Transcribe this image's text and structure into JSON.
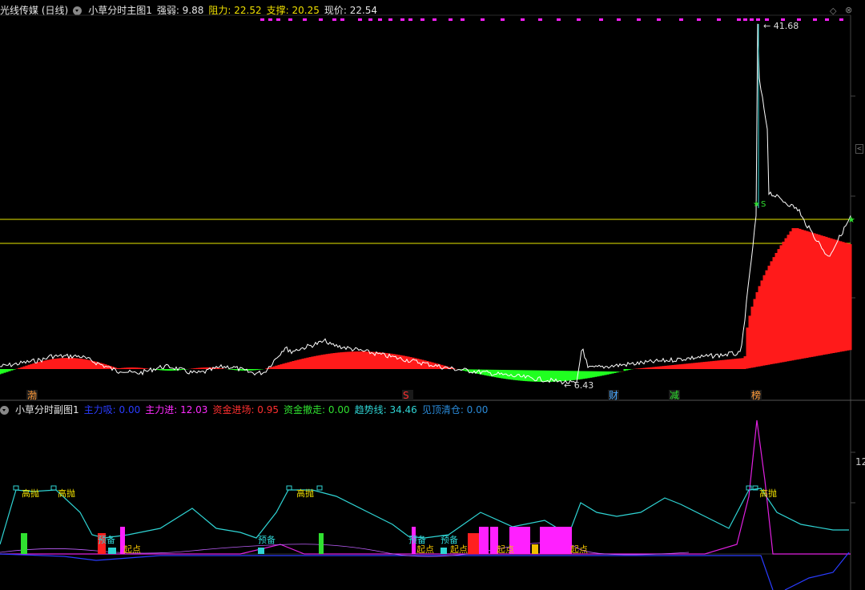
{
  "main_header": {
    "stock": "光线传媒 (日线)",
    "indicator": "小草分时主图1",
    "items": [
      {
        "label": "强弱: ",
        "value": "9.88",
        "color": "#e6e6e6"
      },
      {
        "label": "阻力: ",
        "value": "22.52",
        "color": "#f0e000"
      },
      {
        "label": "支撑: ",
        "value": "20.25",
        "color": "#f0e000"
      },
      {
        "label": "现价: ",
        "value": "22.54",
        "color": "#e6e6e6"
      }
    ]
  },
  "sub_header": {
    "indicator": "小草分时副图1",
    "items": [
      {
        "label": "主力吸: ",
        "value": "0.00",
        "color": "#2a3cff"
      },
      {
        "label": "主力进: ",
        "value": "12.03",
        "color": "#ff2bff"
      },
      {
        "label": "资金进场: ",
        "value": "0.95",
        "color": "#ff3030"
      },
      {
        "label": "资金撤走: ",
        "value": "0.00",
        "color": "#30e030"
      },
      {
        "label": "趋势线: ",
        "value": "34.46",
        "color": "#2fd4d4"
      },
      {
        "label": "见顶清仓: ",
        "value": "0.00",
        "color": "#2a8ad8"
      }
    ]
  },
  "annotations": {
    "high_price": "41.68",
    "low_price": "6.43",
    "signal_s": "S",
    "marker_s": "S",
    "sub_axis_value": "12",
    "labels": [
      "高抛",
      "高抛",
      "高抛",
      "高抛",
      "预备",
      "预备",
      "预备",
      "起点",
      "起点",
      "起点",
      "起点",
      "起点"
    ],
    "tags": [
      {
        "text": "渤",
        "color": "#ff9b3a"
      },
      {
        "text": "S",
        "color": "#ff3030"
      },
      {
        "text": "财",
        "color": "#4aa8ff"
      },
      {
        "text": "减",
        "color": "#30e030"
      },
      {
        "text": "榜",
        "color": "#ff9b3a"
      }
    ]
  },
  "colors": {
    "red_fill": "#ff1a1a",
    "green_fill": "#20ff20",
    "price_line": "#ffffff",
    "cyan_line": "#2fd4d4",
    "magenta_line": "#e020e0",
    "yellow_line": "#e8e800"
  }
}
